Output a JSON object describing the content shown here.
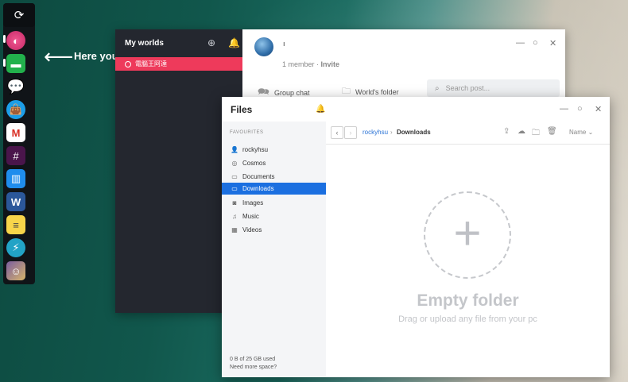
{
  "desktop": {
    "hint_text": "Here you"
  },
  "dock": {
    "items": [
      {
        "name": "sync-icon",
        "color": "#ffffff"
      },
      {
        "name": "planet-icon",
        "color": "#e83f7c"
      },
      {
        "name": "folder-icon",
        "color": "#22b14c"
      },
      {
        "name": "chat-icon",
        "color": "#6bb8e8"
      },
      {
        "name": "shopping-bag-icon",
        "color": "#1d9ee8"
      },
      {
        "name": "gmail-icon",
        "color": "#d93025"
      },
      {
        "name": "slack-icon",
        "color": "#4a154b"
      },
      {
        "name": "intercom-icon",
        "color": "#1f8ded"
      },
      {
        "name": "word-icon",
        "color": "#2b579a"
      },
      {
        "name": "notes-icon",
        "color": "#f7d54a"
      },
      {
        "name": "bolt-icon",
        "color": "#22a3c6"
      },
      {
        "name": "avatar-icon",
        "color": "#7b5ea0"
      }
    ]
  },
  "worlds": {
    "title": "My worlds",
    "items": [
      {
        "label": "電腦王阿達"
      }
    ],
    "world_label": "ı",
    "members_count": "1 member",
    "members_sep": " · ",
    "invite": "Invite",
    "tabs": {
      "group_chat": "Group chat",
      "worlds_folder": "World's folder"
    },
    "search_placeholder": "Search post..."
  },
  "files": {
    "title": "Files",
    "favourites_header": "FAVOURITES",
    "sidebar": [
      {
        "label": "rockyhsu",
        "icon": "user-icon"
      },
      {
        "label": "Cosmos",
        "icon": "cosmos-icon"
      },
      {
        "label": "Documents",
        "icon": "folder-icon"
      },
      {
        "label": "Downloads",
        "icon": "folder-icon"
      },
      {
        "label": "Images",
        "icon": "camera-icon"
      },
      {
        "label": "Music",
        "icon": "music-icon"
      },
      {
        "label": "Videos",
        "icon": "film-icon"
      }
    ],
    "active_item": "Downloads",
    "storage_used": "0 B of 25 GB used",
    "more_space": "Need more space?",
    "breadcrumb": {
      "root": "rockyhsu",
      "separator": "›",
      "current": "Downloads"
    },
    "sort_label": "Name",
    "empty_title": "Empty folder",
    "empty_subtitle": "Drag or upload any file from your pc"
  },
  "colors": {
    "accent": "#1b6fe0",
    "world_active": "#ee3a5b"
  }
}
